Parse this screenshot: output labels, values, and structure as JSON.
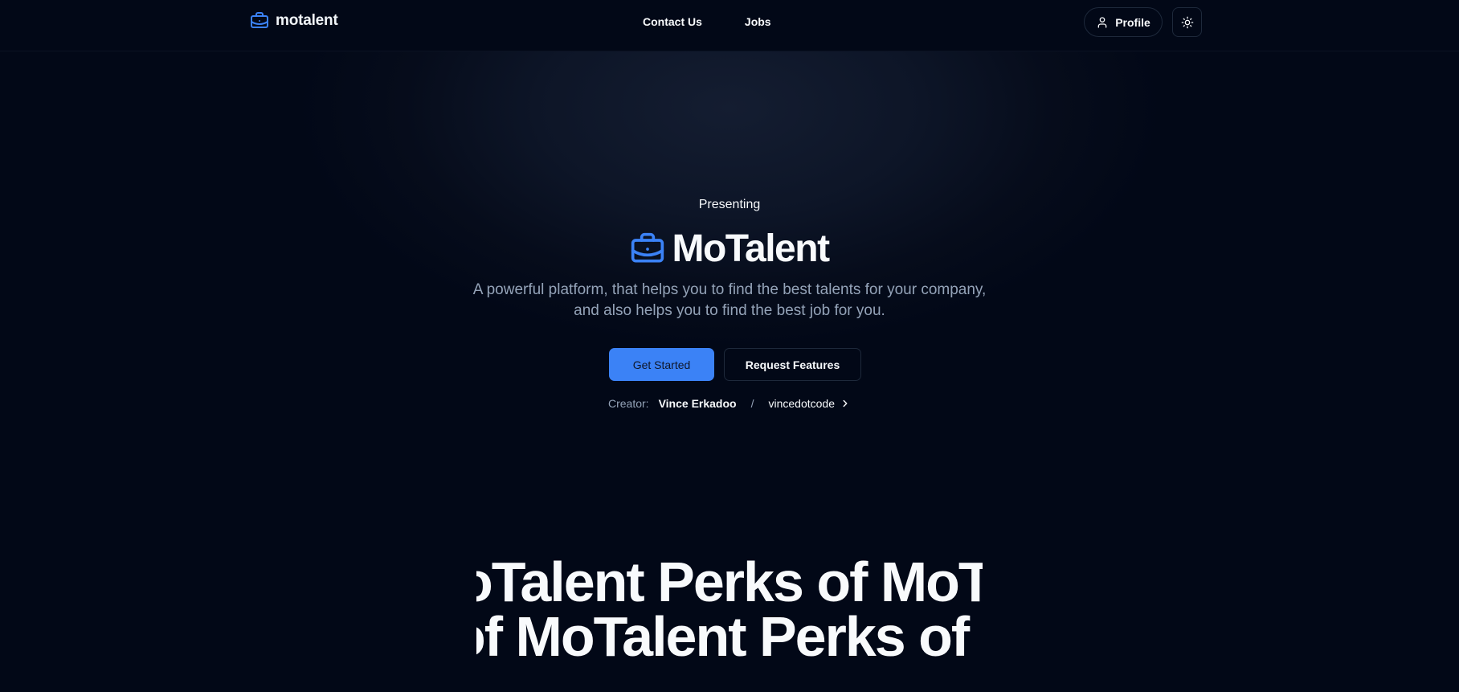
{
  "header": {
    "logo_text": "motalent",
    "nav": [
      {
        "label": "Contact Us"
      },
      {
        "label": "Jobs"
      }
    ],
    "profile_label": "Profile",
    "icons": {
      "logo": "briefcase-icon",
      "profile": "user-icon",
      "theme": "sun-icon"
    }
  },
  "hero": {
    "eyebrow": "Presenting",
    "title": "MoTalent",
    "tagline": "A powerful platform, that helps you to find the best talents for your company, and also helps you to find the best job for you.",
    "primary_cta": "Get Started",
    "secondary_cta": "Request Features",
    "creator": {
      "label": "Creator:",
      "name": "Vince Erkadoo",
      "separator": "/",
      "handle": "vincedotcode"
    }
  },
  "marquee": {
    "line1": "oTalent Perks of MoT",
    "line2": "of MoTalent Perks of"
  },
  "colors": {
    "background": "#020817",
    "accent": "#3b82f6",
    "muted_text": "#94a3b8",
    "border": "#1e293b"
  }
}
